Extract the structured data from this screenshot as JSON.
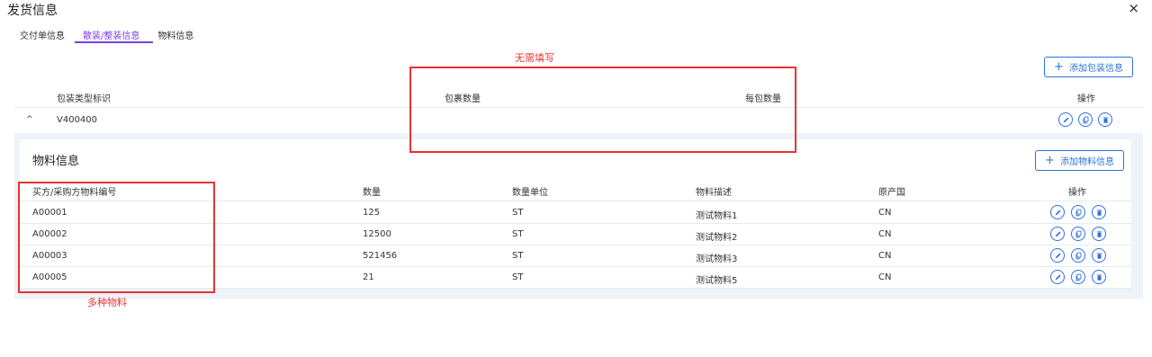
{
  "dialog": {
    "title": "发货信息",
    "close_glyph": "×"
  },
  "tabs": [
    {
      "label": "交付单信息",
      "active": false
    },
    {
      "label": "散装/整装信息",
      "active": true
    },
    {
      "label": "物料信息",
      "active": false
    }
  ],
  "package": {
    "add_button_label": "添加包装信息",
    "columns": [
      "包装类型标识",
      "包裹数量",
      "每包数量",
      "操作"
    ],
    "rows": [
      {
        "type_id": "V400400",
        "package_count": "",
        "per_package": ""
      }
    ]
  },
  "material": {
    "title": "物料信息",
    "add_button_label": "添加物料信息",
    "columns": [
      "买方/采购方物料编号",
      "数量",
      "数量单位",
      "物料描述",
      "原产国",
      "操作"
    ],
    "rows": [
      {
        "code": "A00001",
        "qty": "125",
        "unit": "ST",
        "desc": "测试物料1",
        "origin": "CN"
      },
      {
        "code": "A00002",
        "qty": "12500",
        "unit": "ST",
        "desc": "测试物料2",
        "origin": "CN"
      },
      {
        "code": "A00003",
        "qty": "521456",
        "unit": "ST",
        "desc": "测试物料3",
        "origin": "CN"
      },
      {
        "code": "A00005",
        "qty": "21",
        "unit": "ST",
        "desc": "测试物料5",
        "origin": "CN"
      }
    ]
  },
  "annotations": {
    "no_fill_needed": "无需填写",
    "multiple_materials": "多种物料"
  },
  "icons": {
    "close": "close-icon",
    "expand": "chevron-up-icon",
    "edit": "pencil-icon",
    "copy": "copy-icon",
    "delete": "trash-icon",
    "add": "plus-icon"
  },
  "colors": {
    "accent": "#2f6fe0",
    "active_tab": "#7b3fe4",
    "annotation": "#e53333",
    "panel_bg": "#eef2f9"
  }
}
